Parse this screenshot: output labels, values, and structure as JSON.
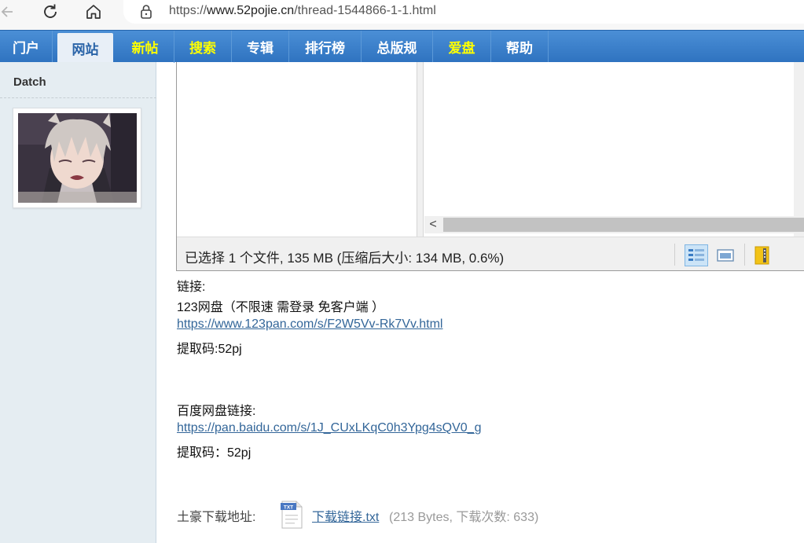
{
  "browser": {
    "url_prefix": "https://",
    "url_host": "www.52pojie.cn",
    "url_path": "/thread-1544866-1-1.html"
  },
  "site_nav": {
    "items": [
      {
        "label": "门户",
        "style": "normal"
      },
      {
        "label": "网站",
        "style": "active"
      },
      {
        "label": "新帖",
        "style": "yellow"
      },
      {
        "label": "搜索",
        "style": "yellow"
      },
      {
        "label": "专辑",
        "style": "normal"
      },
      {
        "label": "排行榜",
        "style": "normal"
      },
      {
        "label": "总版规",
        "style": "normal"
      },
      {
        "label": "爱盘",
        "style": "yellow"
      },
      {
        "label": "帮助",
        "style": "normal"
      }
    ]
  },
  "user": {
    "name": "Datch"
  },
  "screenshot": {
    "status_text": "已选择 1 个文件, 135 MB (压缩后大小: 134 MB, 0.6%)",
    "scroll_arrow": "<"
  },
  "post": {
    "link_label": "链接:",
    "pan123_title": "123网盘（不限速 需登录 免客户端 ）",
    "pan123_url": "https://www.123pan.com/s/F2W5Vv-Rk7Vv.html",
    "pan123_code": "提取码:52pj",
    "baidu_label": "百度网盘链接:",
    "baidu_url": "https://pan.baidu.com/s/1J_CUxLKqC0h3Ypg4sQV0_g",
    "baidu_code": "提取码：52pj"
  },
  "attachment": {
    "label": "土豪下载地址:",
    "icon_text": "TXT",
    "file_name": "下载链接.txt",
    "meta": "(213 Bytes, 下载次数: 633)"
  },
  "colors": {
    "nav_blue": "#3b80cc",
    "nav_yellow": "#ffff00",
    "link": "#336699",
    "sidebar_bg": "#e5edf2"
  }
}
